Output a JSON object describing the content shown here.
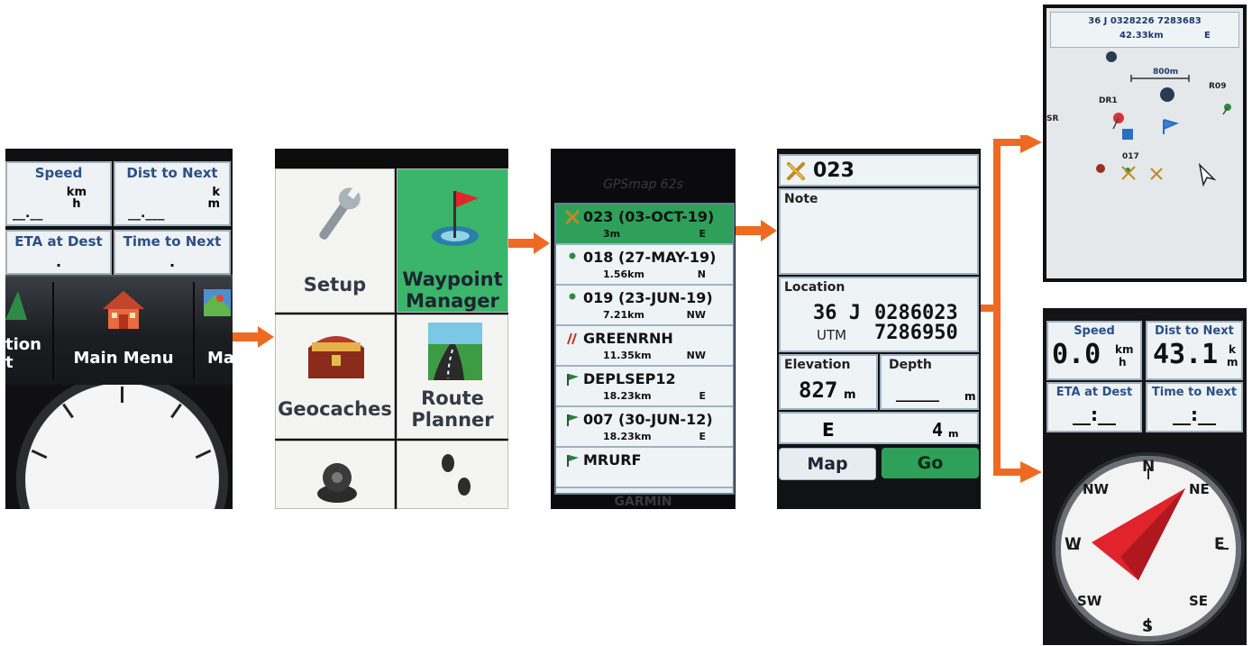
{
  "trip": {
    "speed_label": "Speed",
    "speed_unit_top": "km",
    "speed_unit_bottom": "h",
    "speed_value": "__.__",
    "dist_label": "Dist to Next",
    "dist_unit_top": "k",
    "dist_unit_bottom": "m",
    "dist_value": "__.___",
    "eta_label": "ETA at Dest",
    "eta_value": ".",
    "time_label": "Time to Next",
    "time_value": ".",
    "menu_left_label": "tion",
    "menu_left_label2": "t",
    "menu_center_label": "Main Menu",
    "menu_right_label": "Ma"
  },
  "main_menu": {
    "items": [
      {
        "label": "Setup"
      },
      {
        "label": "Waypoint",
        "label2": "Manager"
      },
      {
        "label": "Geocaches"
      },
      {
        "label": "Route",
        "label2": "Planner"
      }
    ]
  },
  "waypoint_list": {
    "brand_top": "GPSmap 62s",
    "brand_bottom": "GARMIN",
    "rows": [
      {
        "name": "023 (03-OCT-19)",
        "dist": "3m",
        "dir": "E",
        "icon": "crossed-picks-icon",
        "selected": true
      },
      {
        "name": "018 (27-MAY-19)",
        "dist": "1.56km",
        "dir": "N",
        "icon": "dot-icon"
      },
      {
        "name": "019 (23-JUN-19)",
        "dist": "7.21km",
        "dir": "NW",
        "icon": "dot-icon"
      },
      {
        "name": "GREENRNH",
        "dist": "11.35km",
        "dir": "NW",
        "icon": "tracks-icon"
      },
      {
        "name": "DEPLSEP12",
        "dist": "18.23km",
        "dir": "E",
        "icon": "flag-icon"
      },
      {
        "name": "007 (30-JUN-12)",
        "dist": "18.23km",
        "dir": "E",
        "icon": "flag-icon"
      },
      {
        "name": "MRURF",
        "dist": "",
        "dir": "",
        "icon": "flag-icon"
      }
    ]
  },
  "waypoint_detail": {
    "name": "023",
    "note_label": "Note",
    "location_label": "Location",
    "zone": "36 J",
    "easting": "0286023",
    "datum": "UTM",
    "northing": "7286950",
    "elevation_label": "Elevation",
    "elevation_value": "827",
    "elevation_unit": "m",
    "depth_label": "Depth",
    "depth_value": "______",
    "depth_unit": "m",
    "bearing": "E",
    "distance": "4",
    "distance_unit": "m",
    "map_button": "Map",
    "go_button": "Go"
  },
  "map": {
    "coords": "36 J 0328226  7283683",
    "distance": "42.33km",
    "bearing": "E",
    "scale": "800m",
    "labels": [
      "DR1",
      "017",
      "R09",
      "SR"
    ]
  },
  "compass": {
    "speed_label": "Speed",
    "speed_value": "0.0",
    "speed_unit_top": "km",
    "speed_unit_bottom": "h",
    "dist_label": "Dist to Next",
    "dist_value": "43.1",
    "dist_unit_top": "k",
    "dist_unit_bottom": "m",
    "eta_label": "ETA at Dest",
    "eta_value": "__:__",
    "time_label": "Time to Next",
    "time_value": "__:__",
    "cardinals": {
      "n": "N",
      "ne": "NE",
      "e": "E",
      "se": "SE",
      "s": "S",
      "sw": "SW",
      "w": "W",
      "nw": "NW"
    }
  },
  "colors": {
    "arrow": "#ee6a22",
    "selection_green": "#2fa05a",
    "label_blue": "#2b4f86",
    "needle_red": "#e1242c"
  }
}
